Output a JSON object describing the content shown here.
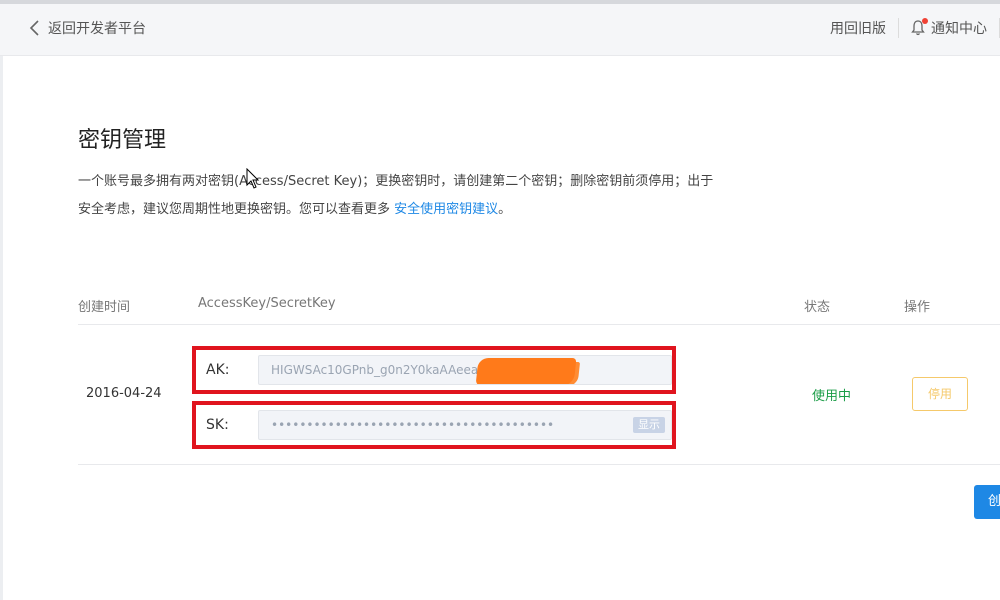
{
  "header": {
    "back_label": "返回开发者平台",
    "old_version_label": "用回旧版",
    "notify_label": "通知中心",
    "icons": {
      "back": "chevron-left-icon",
      "notify": "bell-icon"
    }
  },
  "page": {
    "title": "密钥管理",
    "description_part1": "一个账号最多拥有两对密钥(Access/Secret Key)；更换密钥时，请创建第二个密钥；删除密钥前须停用；出于安全考虑，建议您周期性地更换密钥。您可以查看更多 ",
    "description_link": "安全使用密钥建议",
    "description_end": "。"
  },
  "table": {
    "columns": {
      "created": "创建时间",
      "keys": "AccessKey/SecretKey",
      "status": "状态",
      "action": "操作"
    },
    "rows": [
      {
        "created": "2016-04-24",
        "ak_label": "AK:",
        "ak_value": "HIGWSAc10GPnb_g0n2Y0kaAAeeama",
        "sk_label": "SK:",
        "sk_value": "••••••••••••••••••••••••••••••••••••••••",
        "show_label": "显示",
        "status": "使用中",
        "action_label": "停用"
      }
    ]
  },
  "create_button_label": "创",
  "colors": {
    "accent": "#1e88e5",
    "status_active": "#1a9c46",
    "warn": "#f5c96b",
    "highlight_box": "#e0141e",
    "redaction": "#ff7a1a"
  }
}
